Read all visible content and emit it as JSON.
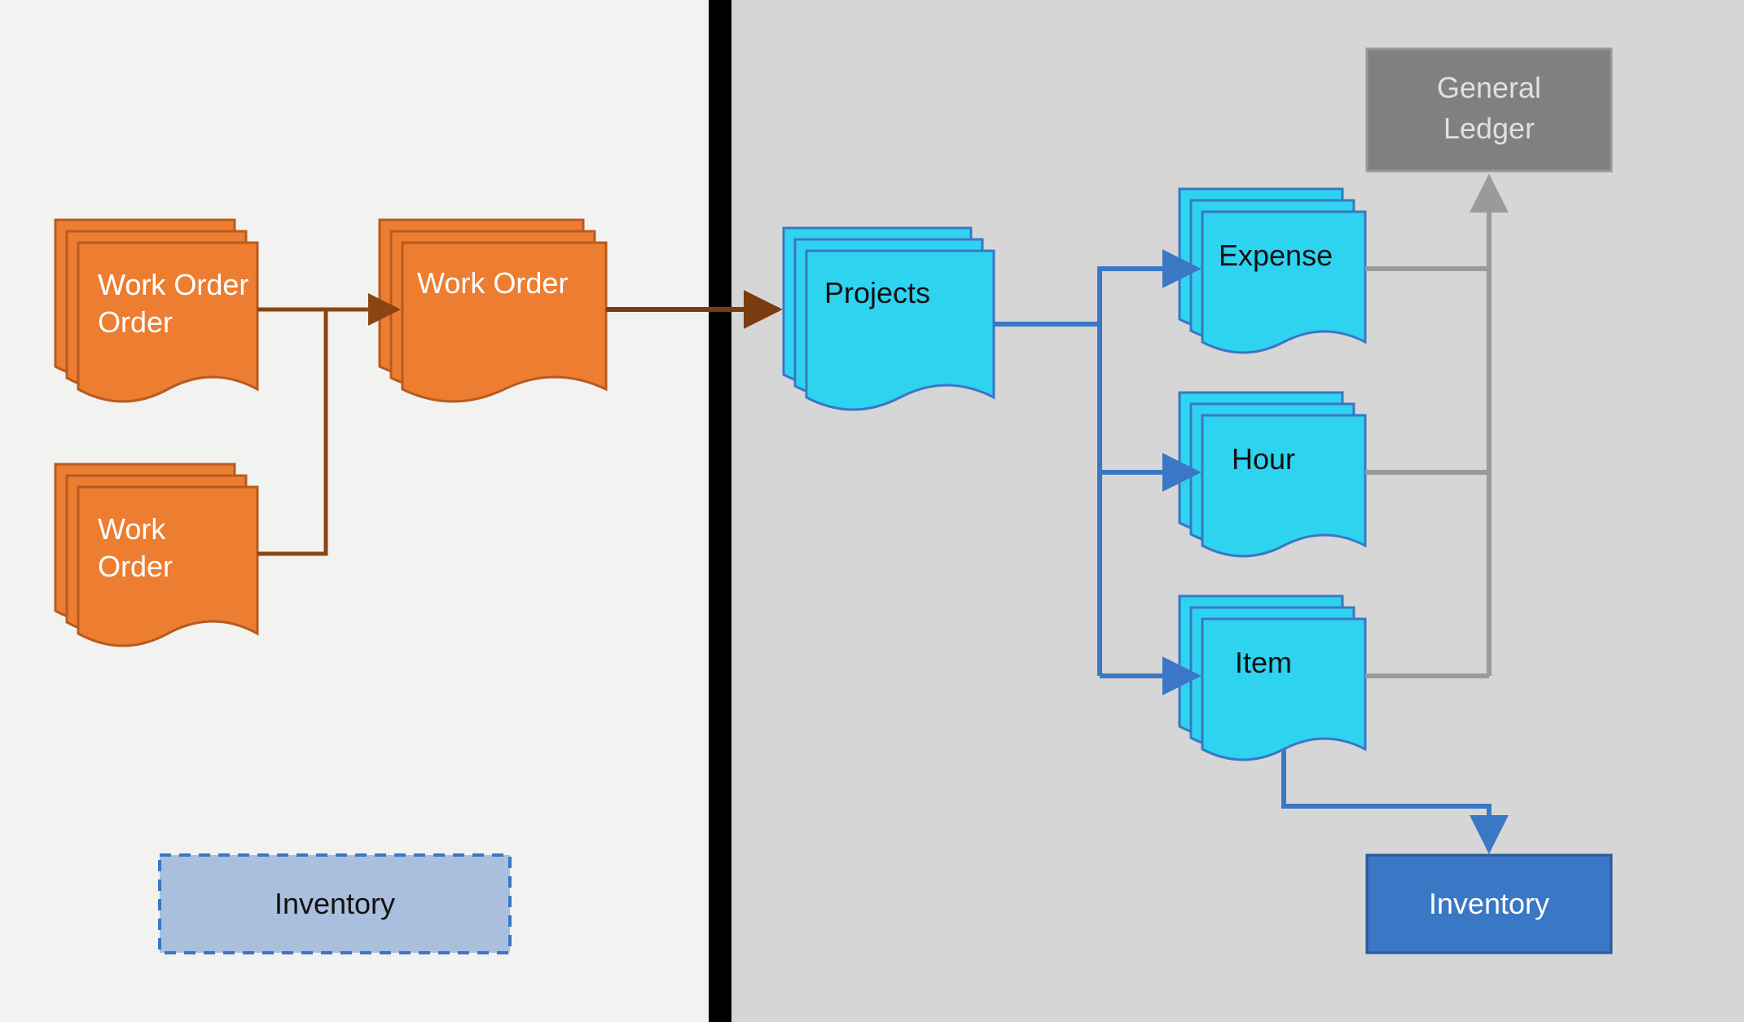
{
  "diagram": {
    "left_panel_color": "#f2f2f0",
    "right_panel_color": "#d6d6d6",
    "divider_color": "#000000",
    "colors": {
      "orange_fill": "#ed7d31",
      "orange_stroke": "#b85a1f",
      "orange_arrow": "#8b4513",
      "cyan_fill": "#2ed3f0",
      "cyan_stroke": "#3a77c4",
      "blue_arrow": "#3a77c4",
      "gray_box_fill": "#808080",
      "gray_box_stroke": "#9a9a9a",
      "gray_arrow": "#9a9a9a",
      "inventory_left_fill": "#a9bfdd",
      "inventory_left_stroke": "#3a77c4",
      "inventory_right_fill": "#3a77c4",
      "inventory_right_text": "#ffffff"
    },
    "nodes": {
      "work_order_stack_top": "Work Order",
      "work_order_stack_bottom": "Work Order",
      "work_order_single": "Work Order",
      "projects": "Projects",
      "expense": "Expense",
      "hour": "Hour",
      "item": "Item",
      "general_ledger_line1": "General",
      "general_ledger_line2": "Ledger",
      "inventory_left": "Inventory",
      "inventory_right": "Inventory"
    }
  }
}
